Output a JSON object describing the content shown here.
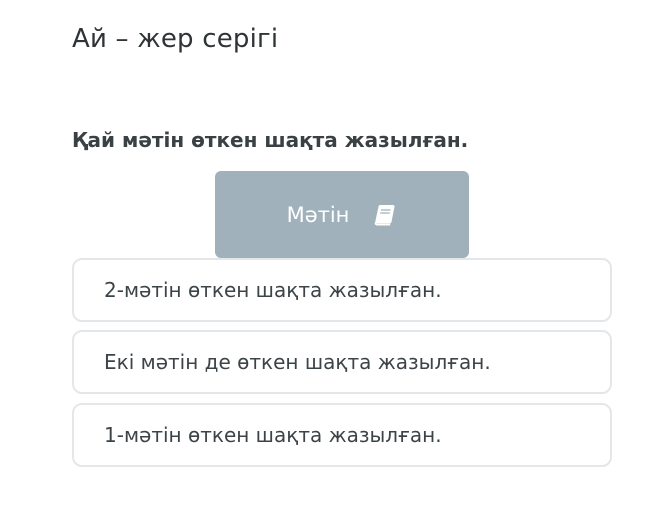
{
  "header": {
    "title": "Ай – жер серігі"
  },
  "question": {
    "text": "Қай мәтін өткен шақта жазылған."
  },
  "text_button": {
    "label": "Мәтін",
    "icon": "book-icon",
    "background": "#a0b1bc"
  },
  "options": [
    {
      "label": "2-мәтін өткен шақта жазылған."
    },
    {
      "label": "Екі мәтін де өткен шақта жазылған."
    },
    {
      "label": "1-мәтін өткен шақта жазылған."
    }
  ]
}
